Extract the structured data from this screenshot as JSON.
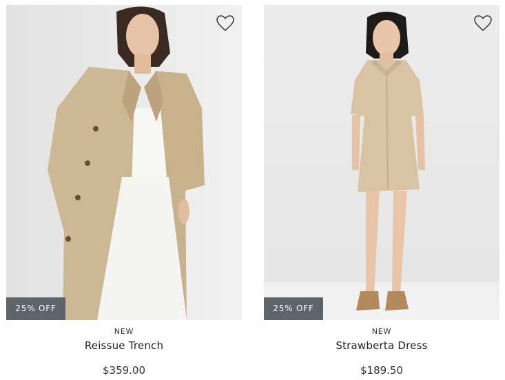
{
  "products": [
    {
      "tag": "NEW",
      "name": "Reissue Trench",
      "price": "$359.00",
      "badge": "25% OFF",
      "image_alt": "Model wearing a beige trench coat over white top and white trousers"
    },
    {
      "tag": "NEW",
      "name": "Strawberta Dress",
      "price": "$189.50",
      "badge": "25% OFF",
      "image_alt": "Model wearing a beige shirt dress with tan sandals"
    }
  ],
  "colors": {
    "photo_bg": "#ebebeb",
    "badge_bg": "#5d646b",
    "badge_text": "#ffffff",
    "beige": "#cdb896"
  },
  "icons": [
    "heart-outline-icon"
  ]
}
